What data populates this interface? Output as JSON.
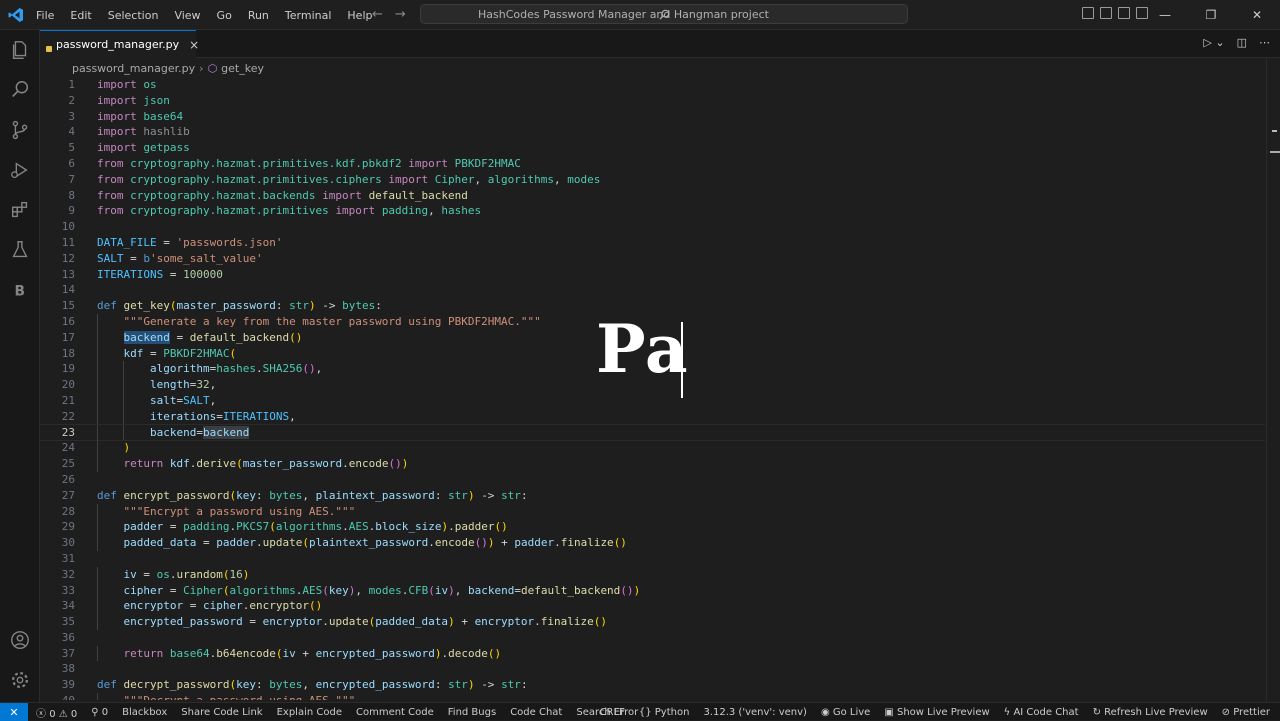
{
  "titlebar": {
    "menu": [
      "File",
      "Edit",
      "Selection",
      "View",
      "Go",
      "Run",
      "Terminal",
      "Help"
    ],
    "search_text": "HashCodes Password Manager and Hangman project"
  },
  "tab": {
    "name": "password_manager.py",
    "close": "×"
  },
  "breadcrumb": {
    "file": "password_manager.py",
    "symbol": "get_key"
  },
  "overlay": {
    "text": "Pa"
  },
  "code_lines": [
    {
      "n": "1",
      "html": "<span class='kw'>import</span> <span class='mod'>os</span>"
    },
    {
      "n": "2",
      "html": "<span class='kw'>import</span> <span class='mod'>json</span>"
    },
    {
      "n": "3",
      "html": "<span class='kw'>import</span> <span class='mod'>base64</span>"
    },
    {
      "n": "4",
      "html": "<span class='kw'>import</span> <span class='hash'>hashlib</span>"
    },
    {
      "n": "5",
      "html": "<span class='kw'>import</span> <span class='mod'>getpass</span>"
    },
    {
      "n": "6",
      "html": "<span class='kw'>from</span> <span class='mod'>cryptography.hazmat.primitives.kdf.pbkdf2</span> <span class='kw'>import</span> <span class='cls'>PBKDF2HMAC</span>"
    },
    {
      "n": "7",
      "html": "<span class='kw'>from</span> <span class='mod'>cryptography.hazmat.primitives.ciphers</span> <span class='kw'>import</span> <span class='cls'>Cipher</span><span class='pl'>, </span><span class='mod'>algorithms</span><span class='pl'>, </span><span class='mod'>modes</span>"
    },
    {
      "n": "8",
      "html": "<span class='kw'>from</span> <span class='mod'>cryptography.hazmat.backends</span> <span class='kw'>import</span> <span class='fn'>default_backend</span>"
    },
    {
      "n": "9",
      "html": "<span class='kw'>from</span> <span class='mod'>cryptography.hazmat.primitives</span> <span class='kw'>import</span> <span class='mod'>padding</span><span class='pl'>, </span><span class='mod'>hashes</span>"
    },
    {
      "n": "10",
      "html": ""
    },
    {
      "n": "11",
      "html": "<span class='con'>DATA_FILE</span> <span class='pl'>=</span> <span class='str'>'passwords.json'</span>"
    },
    {
      "n": "12",
      "html": "<span class='con'>SALT</span> <span class='pl'>=</span> <span class='def'>b</span><span class='str'>'some_salt_value'</span>"
    },
    {
      "n": "13",
      "html": "<span class='con'>ITERATIONS</span> <span class='pl'>=</span> <span class='num'>100000</span>"
    },
    {
      "n": "14",
      "html": ""
    },
    {
      "n": "15",
      "html": "<span class='def'>def</span> <span class='fn'>get_key</span><span class='b1'>(</span><span class='var'>master_password</span><span class='pl'>: </span><span class='cls'>str</span><span class='b1'>)</span> <span class='pl'>-&gt;</span> <span class='cls'>bytes</span><span class='pl'>:</span>"
    },
    {
      "n": "16",
      "html": "    <span class='str'>\"\"\"Generate a key from the master password using PBKDF2HMAC.\"\"\"</span>"
    },
    {
      "n": "17",
      "html": "    <span class='var sel'>backend</span> <span class='pl'>=</span> <span class='fn'>default_backend</span><span class='b1'>()</span>"
    },
    {
      "n": "18",
      "html": "    <span class='var'>kdf</span> <span class='pl'>=</span> <span class='cls'>PBKDF2HMAC</span><span class='b1'>(</span>"
    },
    {
      "n": "19",
      "html": "        <span class='var'>algorithm</span><span class='pl'>=</span><span class='mod'>hashes</span><span class='pl'>.</span><span class='cls'>SHA256</span><span class='b2'>()</span><span class='pl'>,</span>"
    },
    {
      "n": "20",
      "html": "        <span class='var'>length</span><span class='pl'>=</span><span class='num'>32</span><span class='pl'>,</span>"
    },
    {
      "n": "21",
      "html": "        <span class='var'>salt</span><span class='pl'>=</span><span class='con'>SALT</span><span class='pl'>,</span>"
    },
    {
      "n": "22",
      "html": "        <span class='var'>iterations</span><span class='pl'>=</span><span class='con'>ITERATIONS</span><span class='pl'>,</span>"
    },
    {
      "n": "23",
      "html": "        <span class='var'>backend</span><span class='pl'>=</span><span class='var selh'>backend</span>",
      "current": true
    },
    {
      "n": "24",
      "html": "    <span class='b1'>)</span>"
    },
    {
      "n": "25",
      "html": "    <span class='kw'>return</span> <span class='var'>kdf</span><span class='pl'>.</span><span class='fn'>derive</span><span class='b1'>(</span><span class='var'>master_password</span><span class='pl'>.</span><span class='fn'>encode</span><span class='b2'>()</span><span class='b1'>)</span>"
    },
    {
      "n": "26",
      "html": ""
    },
    {
      "n": "27",
      "html": "<span class='def'>def</span> <span class='fn'>encrypt_password</span><span class='b1'>(</span><span class='var'>key</span><span class='pl'>: </span><span class='cls'>bytes</span><span class='pl'>, </span><span class='var'>plaintext_password</span><span class='pl'>: </span><span class='cls'>str</span><span class='b1'>)</span> <span class='pl'>-&gt;</span> <span class='cls'>str</span><span class='pl'>:</span>"
    },
    {
      "n": "28",
      "html": "    <span class='str'>\"\"\"Encrypt a password using AES.\"\"\"</span>"
    },
    {
      "n": "29",
      "html": "    <span class='var'>padder</span> <span class='pl'>=</span> <span class='mod'>padding</span><span class='pl'>.</span><span class='cls'>PKCS7</span><span class='b1'>(</span><span class='mod'>algorithms</span><span class='pl'>.</span><span class='cls'>AES</span><span class='pl'>.</span><span class='var'>block_size</span><span class='b1'>)</span><span class='pl'>.</span><span class='fn'>padder</span><span class='b1'>()</span>"
    },
    {
      "n": "30",
      "html": "    <span class='var'>padded_data</span> <span class='pl'>=</span> <span class='var'>padder</span><span class='pl'>.</span><span class='fn'>update</span><span class='b1'>(</span><span class='var'>plaintext_password</span><span class='pl'>.</span><span class='fn'>encode</span><span class='b2'>()</span><span class='b1'>)</span> <span class='pl'>+</span> <span class='var'>padder</span><span class='pl'>.</span><span class='fn'>finalize</span><span class='b1'>()</span>"
    },
    {
      "n": "31",
      "html": ""
    },
    {
      "n": "32",
      "html": "    <span class='var'>iv</span> <span class='pl'>=</span> <span class='mod'>os</span><span class='pl'>.</span><span class='fn'>urandom</span><span class='b1'>(</span><span class='num'>16</span><span class='b1'>)</span>"
    },
    {
      "n": "33",
      "html": "    <span class='var'>cipher</span> <span class='pl'>=</span> <span class='cls'>Cipher</span><span class='b1'>(</span><span class='mod'>algorithms</span><span class='pl'>.</span><span class='cls'>AES</span><span class='b2'>(</span><span class='var'>key</span><span class='b2'>)</span><span class='pl'>, </span><span class='mod'>modes</span><span class='pl'>.</span><span class='cls'>CFB</span><span class='b2'>(</span><span class='var'>iv</span><span class='b2'>)</span><span class='pl'>, </span><span class='var'>backend</span><span class='pl'>=</span><span class='fn'>default_backend</span><span class='b2'>()</span><span class='b1'>)</span>"
    },
    {
      "n": "34",
      "html": "    <span class='var'>encryptor</span> <span class='pl'>=</span> <span class='var'>cipher</span><span class='pl'>.</span><span class='fn'>encryptor</span><span class='b1'>()</span>"
    },
    {
      "n": "35",
      "html": "    <span class='var'>encrypted_password</span> <span class='pl'>=</span> <span class='var'>encryptor</span><span class='pl'>.</span><span class='fn'>update</span><span class='b1'>(</span><span class='var'>padded_data</span><span class='b1'>)</span> <span class='pl'>+</span> <span class='var'>encryptor</span><span class='pl'>.</span><span class='fn'>finalize</span><span class='b1'>()</span>"
    },
    {
      "n": "36",
      "html": ""
    },
    {
      "n": "37",
      "html": "    <span class='kw'>return</span> <span class='mod'>base64</span><span class='pl'>.</span><span class='fn'>b64encode</span><span class='b1'>(</span><span class='var'>iv</span> <span class='pl'>+</span> <span class='var'>encrypted_password</span><span class='b1'>)</span><span class='pl'>.</span><span class='fn'>decode</span><span class='b1'>()</span>"
    },
    {
      "n": "38",
      "html": ""
    },
    {
      "n": "39",
      "html": "<span class='def'>def</span> <span class='fn'>decrypt_password</span><span class='b1'>(</span><span class='var'>key</span><span class='pl'>: </span><span class='cls'>bytes</span><span class='pl'>, </span><span class='var'>encrypted_password</span><span class='pl'>: </span><span class='cls'>str</span><span class='b1'>)</span> <span class='pl'>-&gt;</span> <span class='cls'>str</span><span class='pl'>:</span>"
    },
    {
      "n": "40",
      "html": "    <span class='str'>\"\"\"Decrypt a password using AES.\"\"\"</span>"
    }
  ],
  "statusbar": {
    "errors": "0",
    "warnings": "0",
    "ports": "0",
    "left_items": [
      "Blackbox",
      "Share Code Link",
      "Explain Code",
      "Comment Code",
      "Find Bugs",
      "Code Chat",
      "Search Error"
    ],
    "eol": "CRLF",
    "language": "Python",
    "interpreter": "3.12.3 ('venv': venv)",
    "go_live": "Go Live",
    "live_preview": "Show Live Preview",
    "ai_chat": "AI Code Chat",
    "refresh": "Refresh Live Preview",
    "prettier": "Prettier"
  },
  "colors": {
    "accent": "#0078d4",
    "editor_bg": "#1e1e1e",
    "chrome_bg": "#181818"
  }
}
